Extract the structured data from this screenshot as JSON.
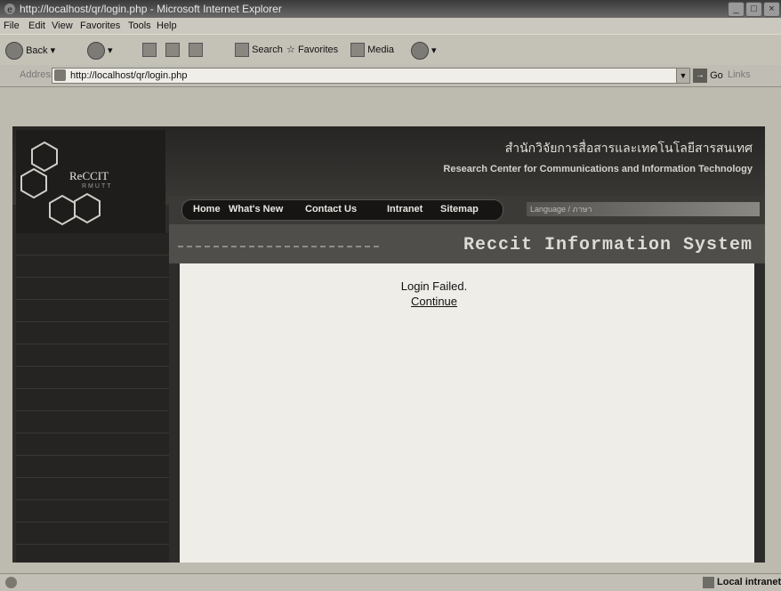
{
  "window": {
    "title": "http://localhost/qr/login.php - Microsoft Internet Explorer"
  },
  "menu": [
    "File",
    "Edit",
    "View",
    "Favorites",
    "Tools",
    "Help"
  ],
  "toolbar": {
    "back": "Back",
    "search": "Search",
    "favorites": "Favorites",
    "media": "Media"
  },
  "address": {
    "label": "Address",
    "url": "http://localhost/qr/login.php",
    "go": "Go",
    "links": "Links"
  },
  "site": {
    "logo": "ReCCIT",
    "logo_sub": "RMUTT",
    "thai_title": "สำนักวิจัยการสื่อสารและเทคโนโลยีสารสนเทศ",
    "eng_title": "Research Center for Communications and Information Technology",
    "nav": [
      "Home",
      "What's New",
      "Contact Us",
      "Intranet",
      "Sitemap"
    ],
    "language": "Language / ภาษา",
    "system_title": "Reccit Information System"
  },
  "content": {
    "message": "Login Failed.",
    "continue": "Continue"
  },
  "status": {
    "zone": "Local intranet"
  },
  "icons": [
    "ie-logo-icon",
    "back-arrow-icon",
    "forward-arrow-icon",
    "stop-icon",
    "refresh-icon",
    "home-icon",
    "search-icon",
    "favorites-star-icon",
    "media-icon",
    "history-icon",
    "page-icon",
    "go-arrow-icon",
    "local-intranet-icon"
  ]
}
